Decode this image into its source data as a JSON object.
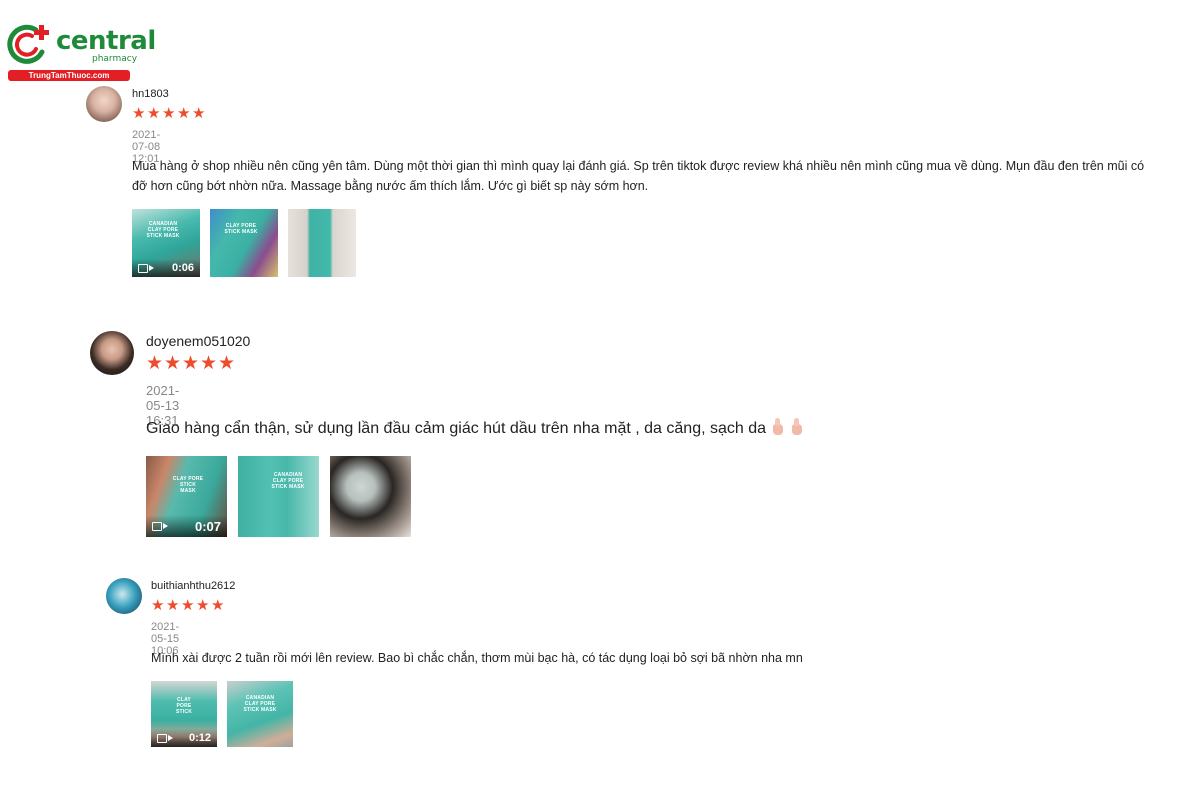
{
  "logo": {
    "word": "central",
    "sub": "pharmacy",
    "bar": "TrungTamThuoc.com",
    "colors": {
      "green": "#1f8a3a",
      "red": "#e31e24"
    }
  },
  "rating_color": "#ee4d2d",
  "reviews": [
    {
      "username": "hn1803",
      "rating": 5,
      "date": "2021-07-08 12:01",
      "comment": "Mua hàng ở shop nhiều nên cũng yên tâm. Dùng một thời gian thì mình quay lại đánh giá. Sp trên tiktok được review khá nhiều nên mình cũng mua về dùng. Mụn đầu đen trên mũi có đỡ hơn cũng bớt nhờn nữa. Massage bằng nước ấm thích lắm. Ước gì biết sp này sớm hơn.",
      "media": [
        {
          "type": "video",
          "duration": "0:06",
          "label": "CANADIAN CLAY PORE STICK MASK"
        },
        {
          "type": "image",
          "label": "CLAY PORE STICK MASK"
        },
        {
          "type": "image",
          "label": ""
        }
      ]
    },
    {
      "username": "doyenem051020",
      "rating": 5,
      "date": "2021-05-13 16:31",
      "comment": "Giao hàng cẩn thận, sử dụng lần đầu cảm giác hút dầu trên nha mặt , da căng, sạch da",
      "media": [
        {
          "type": "video",
          "duration": "0:07",
          "label": "CLAY PORE STICK MASK"
        },
        {
          "type": "image",
          "label": "CANADIAN CLAY PORE STICK MASK"
        },
        {
          "type": "image",
          "label": ""
        }
      ]
    },
    {
      "username": "buithianhthu2612",
      "rating": 5,
      "date": "2021-05-15 10:06",
      "comment": "Mình xài được 2 tuần rồi mới lên review. Bao bì chắc chắn, thơm mùi bạc hà, có tác dụng loại bỏ sợi bã nhờn nha mn",
      "media": [
        {
          "type": "video",
          "duration": "0:12",
          "label": "CLAY PORE STICK"
        },
        {
          "type": "image",
          "label": "CANADIAN CLAY PORE STICK MASK"
        }
      ]
    }
  ]
}
